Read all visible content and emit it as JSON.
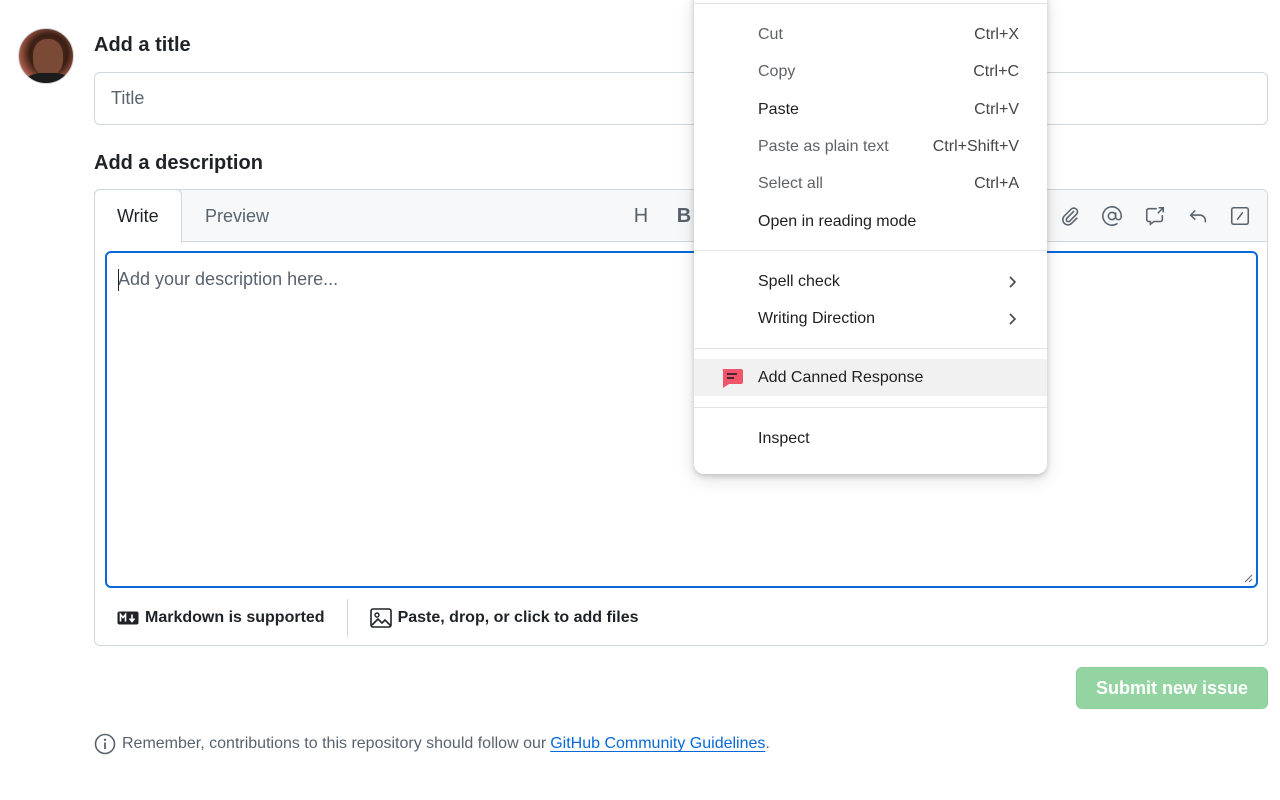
{
  "title_section": {
    "heading": "Add a title",
    "placeholder": "Title"
  },
  "description_section": {
    "heading": "Add a description",
    "tabs": [
      {
        "label": "Write",
        "active": true
      },
      {
        "label": "Preview",
        "active": false
      }
    ],
    "toolbar_visible": [
      "H",
      "B"
    ],
    "toolbar_icons": [
      "attach-icon",
      "mention-icon",
      "cross-reference-icon",
      "reply-icon",
      "slash-command-icon"
    ],
    "textarea_placeholder": "Add your description here...",
    "footer": {
      "markdown_label": "Markdown is supported",
      "files_label": "Paste, drop, or click to add files"
    }
  },
  "submit_button": {
    "label": "Submit new issue",
    "color": "#94d3a2"
  },
  "guidelines_note": {
    "prefix": "Remember, contributions to this repository should follow our",
    "link": "GitHub Community Guidelines",
    "suffix": "."
  },
  "context_menu": {
    "items": [
      {
        "label": "Cut",
        "shortcut": "Ctrl+X",
        "enabled": false
      },
      {
        "label": "Copy",
        "shortcut": "Ctrl+C",
        "enabled": false
      },
      {
        "label": "Paste",
        "shortcut": "Ctrl+V",
        "enabled": true
      },
      {
        "label": "Paste as plain text",
        "shortcut": "Ctrl+Shift+V",
        "enabled": false
      },
      {
        "label": "Select all",
        "shortcut": "Ctrl+A",
        "enabled": false
      },
      {
        "label": "Open in reading mode",
        "shortcut": "",
        "enabled": true
      },
      {
        "label": "Spell check",
        "submenu": true
      },
      {
        "label": "Writing Direction",
        "submenu": true
      },
      {
        "label": "Add Canned Response",
        "icon": "canned-response-icon",
        "highlighted": true
      },
      {
        "label": "Inspect"
      }
    ]
  },
  "colors": {
    "accent": "#0969da",
    "submit_disabled": "#94d3a2",
    "canned_icon": "#f0556b"
  }
}
